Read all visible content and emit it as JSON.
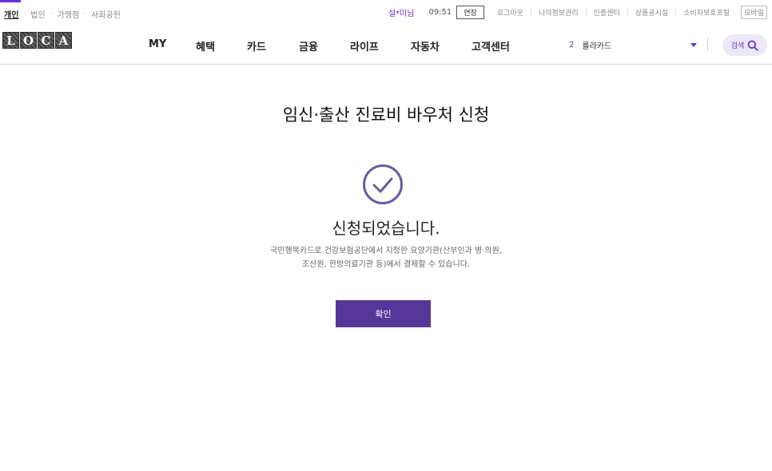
{
  "top_left_tabs": [
    "개인",
    "법인",
    "가맹점",
    "사회공헌"
  ],
  "util": {
    "user_name": "설*미님",
    "time": "09:51",
    "extend_label": "연장",
    "links": [
      "로그아웃",
      "나의정보관리",
      "인증센터",
      "상품공시실",
      "소비자보호포털"
    ],
    "mobile_label": "모바일"
  },
  "logo": {
    "letters": [
      "L",
      "O",
      "C",
      "A"
    ]
  },
  "gnb": {
    "items": [
      "MY",
      "혜택",
      "카드",
      "금융",
      "라이프",
      "자동차",
      "고객센터"
    ]
  },
  "card_select": {
    "count": "2",
    "selected": "롤라카드"
  },
  "search": {
    "label": "검색"
  },
  "main": {
    "page_title": "임신·출산 진료비 바우처 신청",
    "done_title": "신청되었습니다.",
    "desc_line1": "국민행복카드로 건강보험공단에서 지정한 요양기관(산부인과 병·의원,",
    "desc_line2": "조산원, 한방의료기관 등)에서 결제할 수 있습니다.",
    "confirm_label": "확인"
  },
  "colors": {
    "accent": "#6a2bd9",
    "button": "#553699",
    "check": "#6b5ba6"
  }
}
